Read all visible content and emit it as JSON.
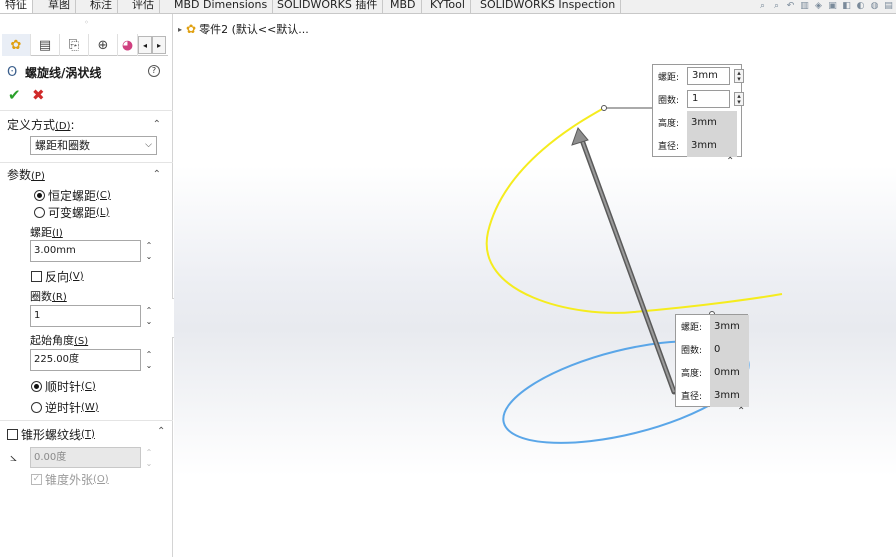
{
  "tabs": [
    {
      "label": "特征",
      "active": true
    },
    {
      "label": "草图"
    },
    {
      "label": "标注"
    },
    {
      "label": "评估"
    },
    {
      "label": "MBD Dimensions"
    },
    {
      "label": "SOLIDWORKS 插件"
    },
    {
      "label": "MBD"
    },
    {
      "label": "KYTool"
    },
    {
      "label": "SOLIDWORKS Inspection"
    }
  ],
  "toolbar_icons": [
    "zoom-fit-icon",
    "zoom-area-icon",
    "previous-view-icon",
    "section-view-icon",
    "view-orientation-icon",
    "display-style-icon",
    "hide-show-icon",
    "appearance-icon",
    "scene-icon",
    "view-settings-icon"
  ],
  "property_manager": {
    "title": "螺旋线/涡状线",
    "help": "?",
    "ok": "✔",
    "cancel": "✖",
    "definition": {
      "header": "定义方式",
      "header_key": "(D)",
      "header_suffix": ":",
      "selected": "螺距和圈数"
    },
    "parameters": {
      "header": "参数",
      "header_key": "(P)",
      "constant_pitch": "恒定螺距",
      "constant_pitch_key": "(C)",
      "variable_pitch": "可变螺距",
      "variable_pitch_key": "(L)",
      "pitch_label": "螺距",
      "pitch_key": "(I)",
      "pitch_value": "3.00mm",
      "reverse_label": "反向",
      "reverse_key": "(V)",
      "revolutions_label": "圈数",
      "revolutions_key": "(R)",
      "revolutions_value": "1",
      "start_angle_label": "起始角度",
      "start_angle_key": "(S)",
      "start_angle_value": "225.00度",
      "clockwise": "顺时针",
      "clockwise_key": "(C)",
      "counterclockwise": "逆时针",
      "counterclockwise_key": "(W)"
    },
    "taper": {
      "header": "锥形螺纹线",
      "header_key": "(T)",
      "angle_value": "0.00度",
      "outward_label": "锥度外张",
      "outward_key": "(O)"
    }
  },
  "viewport": {
    "tree_item": "零件2 (默认<<默认..."
  },
  "callout_top": {
    "rows": [
      {
        "key": "螺距:",
        "value": "3mm"
      },
      {
        "key": "圈数:",
        "value": "1"
      },
      {
        "key": "高度:",
        "value": "3mm"
      },
      {
        "key": "直径:",
        "value": "3mm"
      }
    ]
  },
  "callout_bottom": {
    "rows": [
      {
        "key": "螺距:",
        "value": "3mm"
      },
      {
        "key": "圈数:",
        "value": "0"
      },
      {
        "key": "高度:",
        "value": "0mm"
      },
      {
        "key": "直径:",
        "value": "3mm"
      }
    ]
  },
  "colors": {
    "helix": "#f5ec1e",
    "circle": "#5aa6e8",
    "arrow": "#6e6e6e",
    "ok": "#2aa02a",
    "cancel": "#d02a2a"
  }
}
